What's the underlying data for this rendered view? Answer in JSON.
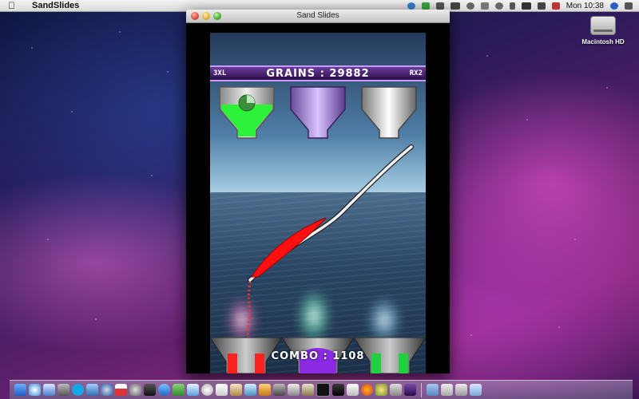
{
  "menubar": {
    "app_name": "SandSlides",
    "clock": "Mon 10:38",
    "status_icons": [
      "globe-icon",
      "vc-icon",
      "network-icon",
      "battery-icon",
      "sync-icon",
      "display-icon",
      "time-machine-icon",
      "bluetooth-icon",
      "wifi-icon",
      "volume-icon",
      "flag-icon",
      "spotlight-icon",
      "list-icon"
    ]
  },
  "desktop": {
    "hd_label": "Macintosh HD"
  },
  "window": {
    "title": "Sand Slides"
  },
  "game": {
    "left_label": "3XL",
    "grains_text": "GRAINS : 29882",
    "right_label": "RX2",
    "combo_text": "COMBO : 1108",
    "hoppers": [
      {
        "color": "green",
        "hex": "#2cf23a",
        "fill_fraction": 0.55
      },
      {
        "color": "purple",
        "hex": "#a070e0",
        "fill_fraction": 0.0
      },
      {
        "color": "white",
        "hex": "#e8e8e8",
        "fill_fraction": 0.0
      }
    ],
    "bins": [
      {
        "color": "red",
        "hex": "#ff2020"
      },
      {
        "color": "purple",
        "hex": "#8a2be2"
      },
      {
        "color": "green",
        "hex": "#20d040"
      }
    ],
    "sand_color": "#ff1010"
  },
  "dock": {
    "icons": [
      "finder-icon",
      "safari-icon",
      "mail-icon",
      "photos-icon",
      "skype-icon",
      "music-icon",
      "itunes-icon",
      "calendar-icon",
      "preferences-icon",
      "chess-icon",
      "app-store-icon",
      "facetime-icon",
      "ichat-icon",
      "cd-icon",
      "textedit-icon",
      "preview-icon",
      "iphoto-icon",
      "garageband-icon",
      "imovie-icon",
      "grab-icon",
      "script-icon",
      "terminal-icon",
      "monitor-icon",
      "vc-icon",
      "firefox-icon",
      "flower-icon",
      "migration-icon",
      "sand-slides-icon",
      "folder-icon",
      "documents-icon",
      "downloads-icon",
      "trash-icon"
    ]
  }
}
